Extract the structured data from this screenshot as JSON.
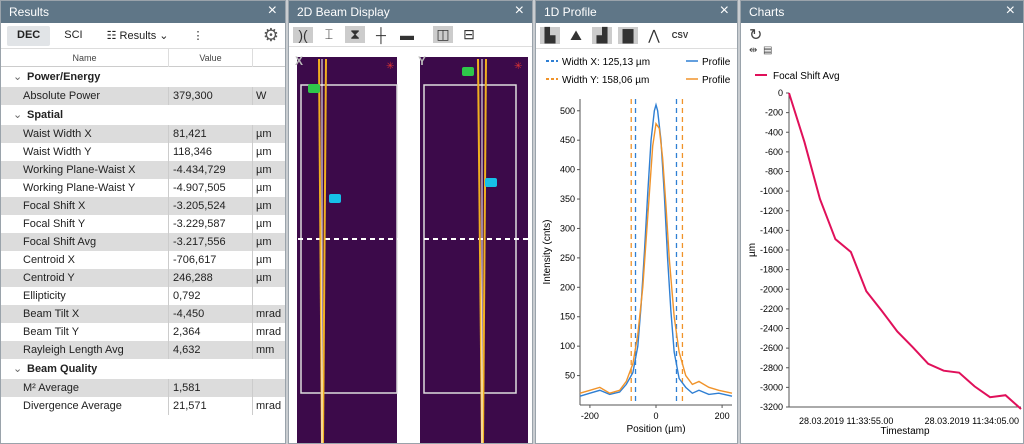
{
  "results": {
    "title": "Results",
    "dec": "DEC",
    "sci": "SCI",
    "results_menu": "Results",
    "col_name": "Name",
    "col_value": "Value",
    "groups": [
      {
        "name": "Power/Energy",
        "rows": [
          [
            "Absolute Power",
            "379,300",
            "W"
          ]
        ]
      },
      {
        "name": "Spatial",
        "rows": [
          [
            "Waist Width X",
            "81,421",
            "µm"
          ],
          [
            "Waist Width Y",
            "118,346",
            "µm"
          ],
          [
            "Working Plane-Waist X",
            "-4.434,729",
            "µm"
          ],
          [
            "Working Plane-Waist Y",
            "-4.907,505",
            "µm"
          ],
          [
            "Focal Shift X",
            "-3.205,524",
            "µm"
          ],
          [
            "Focal Shift Y",
            "-3.229,587",
            "µm"
          ],
          [
            "Focal Shift Avg",
            "-3.217,556",
            "µm"
          ],
          [
            "Centroid X",
            "-706,617",
            "µm"
          ],
          [
            "Centroid Y",
            "246,288",
            "µm"
          ],
          [
            "Ellipticity",
            "0,792",
            ""
          ],
          [
            "Beam Tilt X",
            "-4,450",
            "mrad"
          ],
          [
            "Beam Tilt Y",
            "2,364",
            "mrad"
          ],
          [
            "Rayleigh Length Avg",
            "4,632",
            "mm"
          ]
        ]
      },
      {
        "name": "Beam Quality",
        "rows": [
          [
            "M² Average",
            "1,581",
            ""
          ],
          [
            "Divergence Average",
            "21,571",
            "mrad"
          ]
        ]
      }
    ]
  },
  "beam2d": {
    "title": "2D Beam Display",
    "label_x": "X",
    "label_y": "Y"
  },
  "profile": {
    "title": "1D Profile",
    "csv": "CSV",
    "legend_wx": "Width X: 125,13 µm",
    "legend_wy": "Width Y: 158,06 µm",
    "legend_p1": "Profile",
    "legend_p2": "Profile"
  },
  "charts": {
    "title": "Charts",
    "legend": "Focal Shift Avg"
  },
  "chart_data": [
    {
      "type": "line",
      "title": "",
      "xlabel": "Position  (µm)",
      "ylabel": "Intensity  (cnts)",
      "xlim": [
        -230,
        230
      ],
      "ylim": [
        0,
        520
      ],
      "xticks": [
        -200,
        0,
        200
      ],
      "yticks": [
        50,
        100,
        150,
        200,
        250,
        300,
        350,
        400,
        450,
        500
      ],
      "series": [
        {
          "name": "Profile",
          "color": "#2f7fd3",
          "x": [
            -230,
            -200,
            -170,
            -140,
            -110,
            -90,
            -70,
            -55,
            -45,
            -35,
            -25,
            -15,
            -5,
            0,
            5,
            15,
            25,
            35,
            45,
            55,
            70,
            90,
            110,
            130,
            160,
            190,
            230
          ],
          "y": [
            15,
            20,
            25,
            18,
            22,
            35,
            55,
            100,
            170,
            260,
            360,
            450,
            500,
            510,
            500,
            450,
            360,
            250,
            160,
            90,
            45,
            30,
            20,
            25,
            18,
            20,
            15
          ]
        },
        {
          "name": "Profile",
          "color": "#f0932a",
          "x": [
            -230,
            -200,
            -170,
            -140,
            -110,
            -90,
            -70,
            -55,
            -40,
            -30,
            -20,
            -10,
            0,
            10,
            20,
            30,
            40,
            55,
            70,
            90,
            110,
            130,
            160,
            190,
            230
          ],
          "y": [
            20,
            25,
            30,
            20,
            25,
            40,
            70,
            120,
            200,
            280,
            360,
            440,
            478,
            470,
            420,
            340,
            250,
            150,
            90,
            50,
            35,
            40,
            30,
            25,
            20
          ]
        }
      ],
      "vlines": [
        {
          "x": -75,
          "color": "#f0932a"
        },
        {
          "x": -62,
          "color": "#2f7fd3"
        },
        {
          "x": 62,
          "color": "#2f7fd3"
        },
        {
          "x": 80,
          "color": "#f0932a"
        }
      ]
    },
    {
      "type": "line",
      "title": "",
      "xlabel": "Timestamp",
      "ylabel": "µm",
      "ylim": [
        -3200,
        0
      ],
      "yticks": [
        0,
        -200,
        -400,
        -600,
        -800,
        -1000,
        -1200,
        -1400,
        -1600,
        -1800,
        -2000,
        -2200,
        -2400,
        -2600,
        -2800,
        -3000,
        -3200
      ],
      "xticks_labels": [
        "28.03.2019 11:33:55.00",
        "28.03.2019 11:34:05.00"
      ],
      "series": [
        {
          "name": "Focal Shift Avg",
          "color": "#e0105a",
          "y": [
            0,
            -500,
            -1080,
            -1490,
            -1620,
            -2020,
            -2220,
            -2430,
            -2590,
            -2760,
            -2830,
            -2850,
            -2990,
            -3100,
            -3080,
            -3220
          ]
        }
      ]
    }
  ]
}
